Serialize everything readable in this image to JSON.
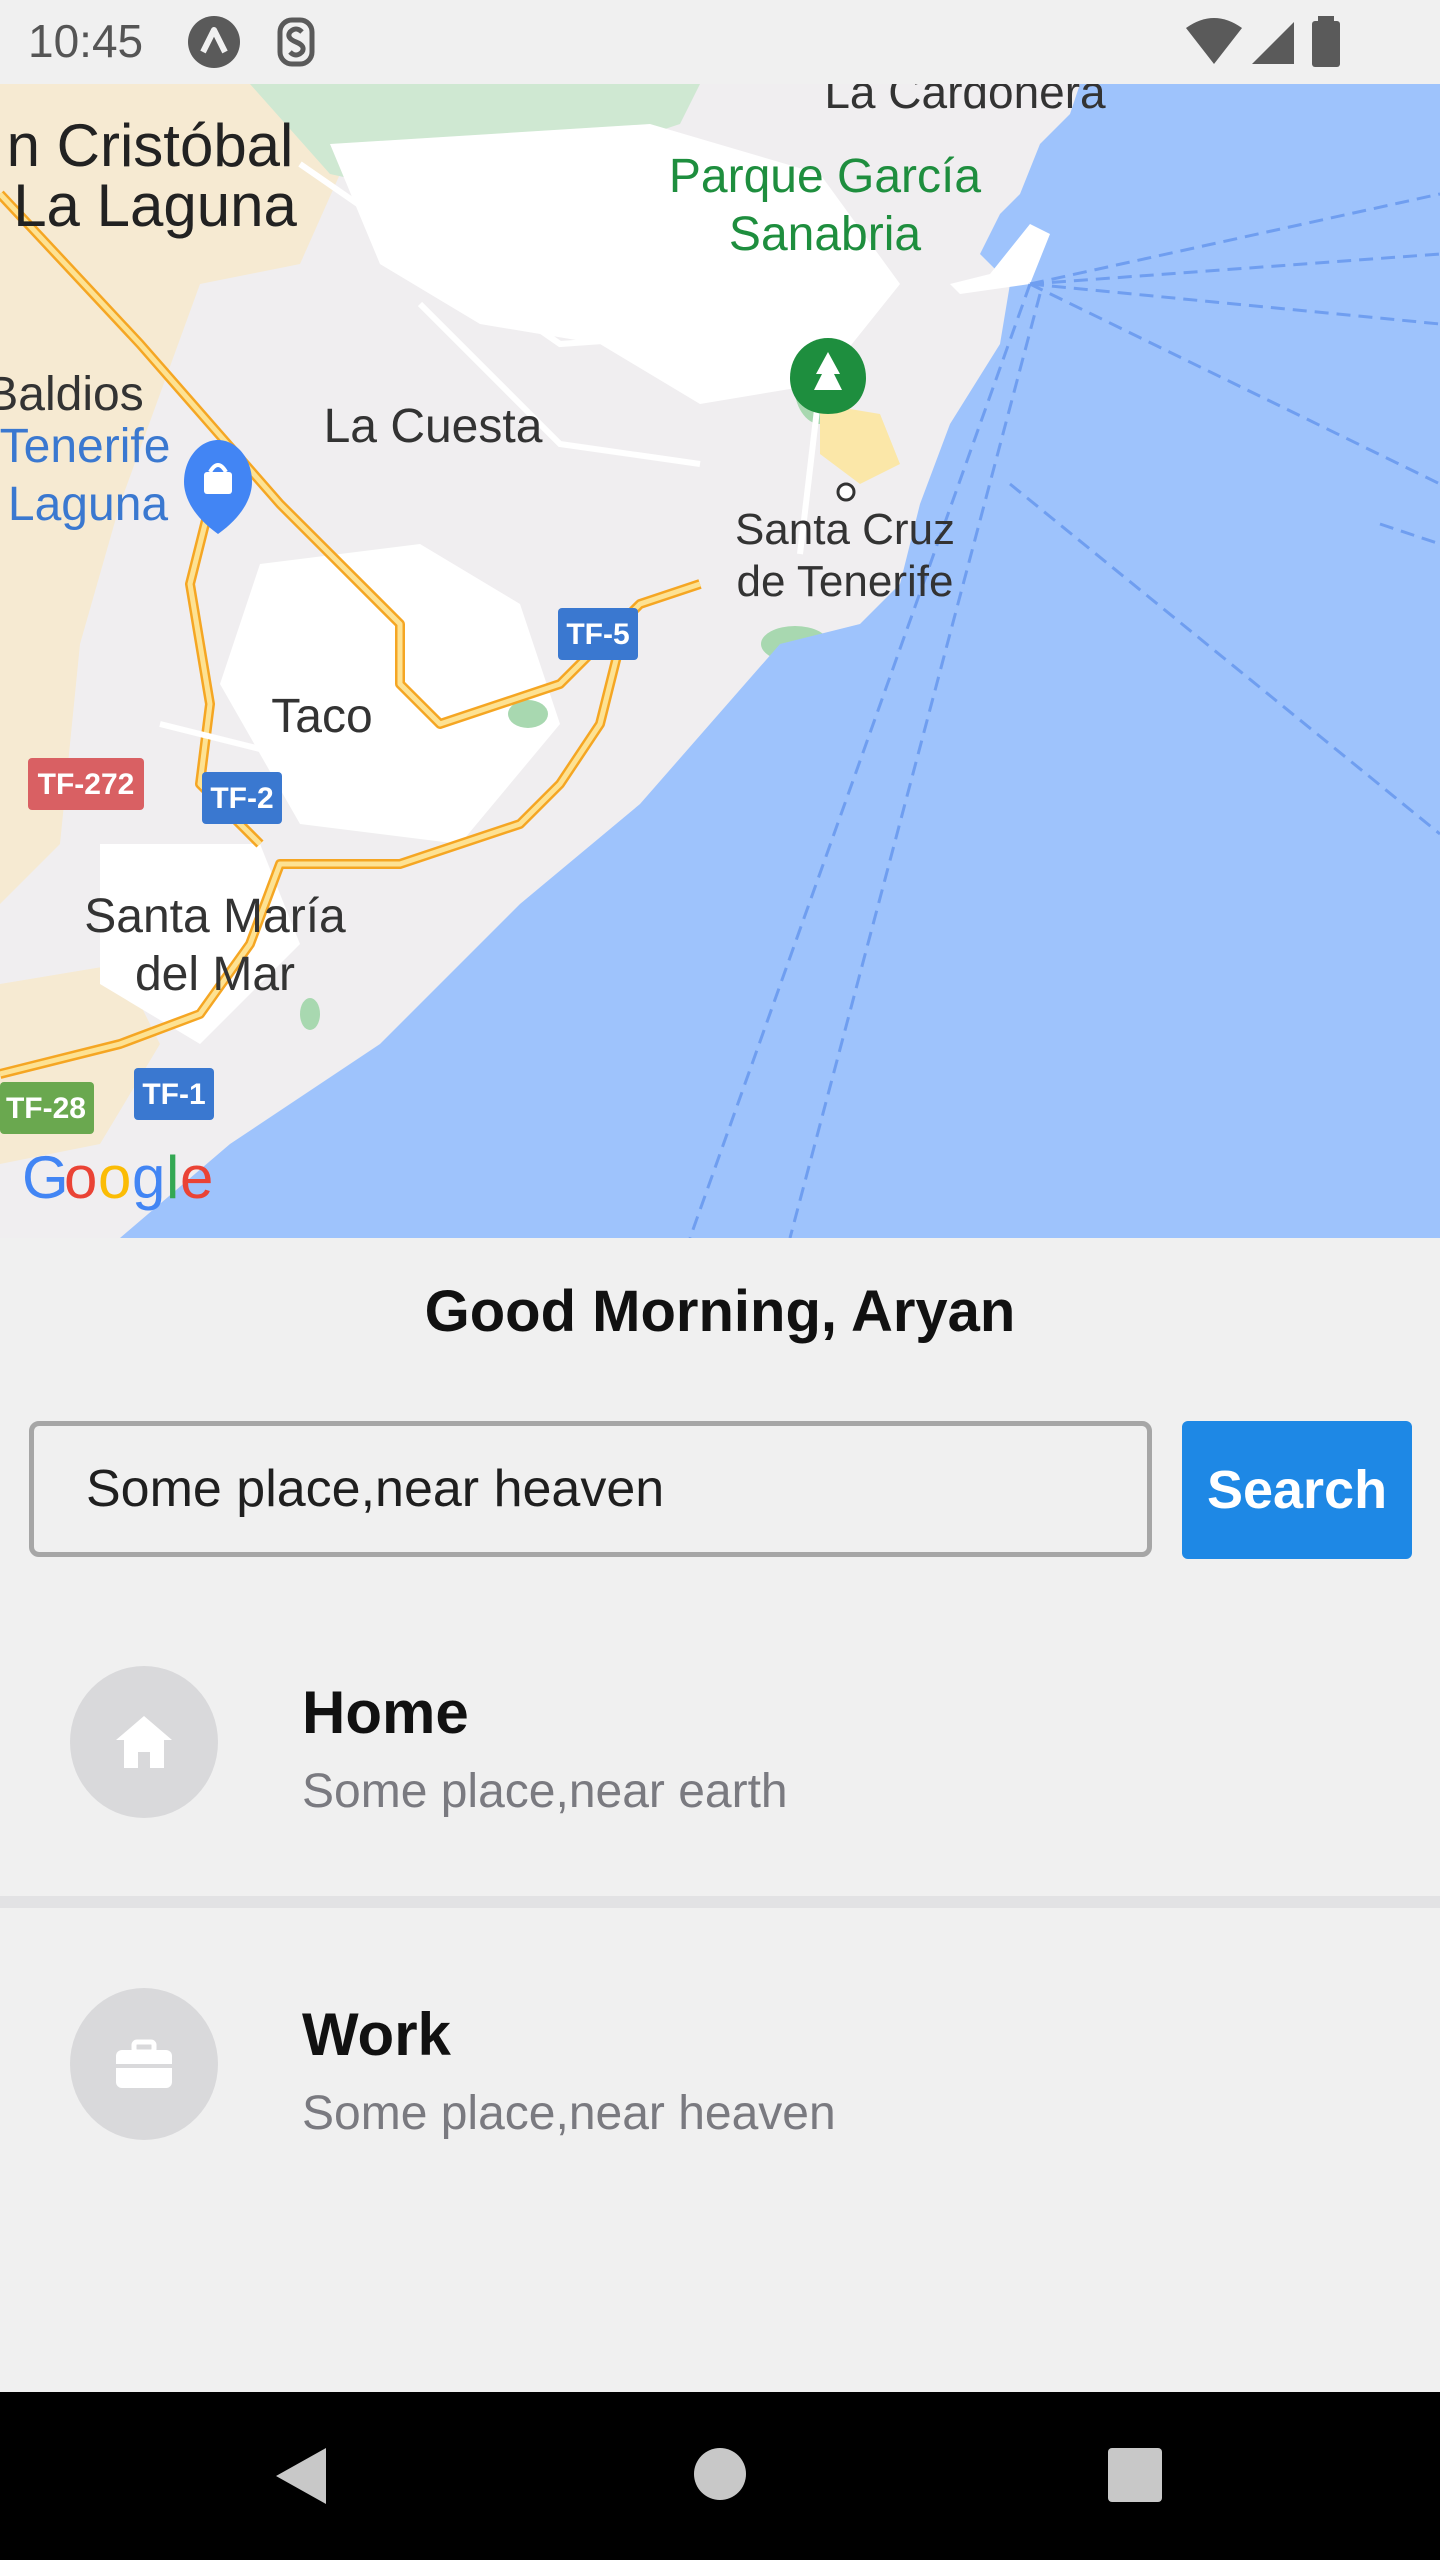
{
  "status_bar": {
    "time": "10:45",
    "icons": [
      "a-icon",
      "s-icon",
      "wifi-icon",
      "signal-icon",
      "battery-icon"
    ]
  },
  "map": {
    "labels": {
      "san_cristobal": "n Cristóbal",
      "la_laguna": "La Laguna",
      "la_cardonera": "La Cardonera",
      "parque_garcia_1": "Parque García",
      "parque_garcia_2": "Sanabria",
      "baldios": "Baldios",
      "tenerife": "Tenerife",
      "laguna": "Laguna",
      "la_cuesta": "La Cuesta",
      "santa_cruz_1": "Santa Cruz",
      "santa_cruz_2": "de Tenerife",
      "taco": "Taco",
      "santa_maria_1": "Santa María",
      "santa_maria_2": "del Mar",
      "tf5": "TF-5",
      "tf272": "TF-272",
      "tf2": "TF-2",
      "tf28": "TF-28",
      "tf1": "TF-1"
    },
    "logo_letters": [
      "G",
      "o",
      "o",
      "g",
      "l",
      "e"
    ],
    "colors": {
      "water": "#9ec3fc",
      "land": "#f0eef0",
      "road": "#f9c74f",
      "park": "#a8d8b0",
      "park_text": "#1e8e3e",
      "poi_blue": "#4285f4"
    }
  },
  "greeting": "Good Morning, Aryan",
  "search": {
    "value": "Some place,near heaven",
    "button_label": "Search"
  },
  "places": [
    {
      "icon": "home-icon",
      "title": "Home",
      "subtitle": "Some place,near earth"
    },
    {
      "icon": "briefcase-icon",
      "title": "Work",
      "subtitle": "Some place,near heaven"
    }
  ],
  "colors": {
    "accent": "#1e88e5"
  }
}
